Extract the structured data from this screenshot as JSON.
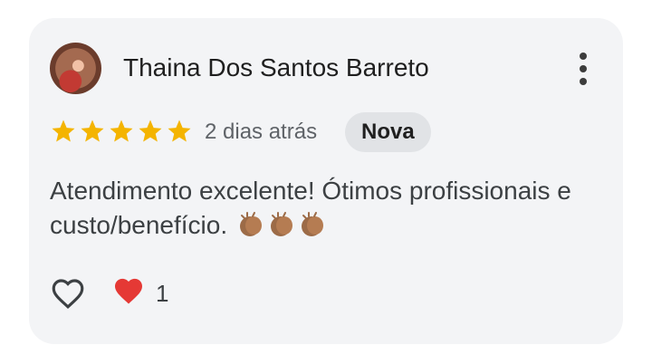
{
  "review": {
    "author": "Thaina Dos Santos Barreto",
    "rating": 5,
    "date": "2 dias atrás",
    "badge": "Nova",
    "text": "Atendimento excelente! Ótimos profissionais e custo/benefício.",
    "emoji": "clapping-hands",
    "reactions": {
      "heart_count": "1"
    }
  },
  "colors": {
    "card_bg": "#f3f4f6",
    "star": "#f4b400",
    "heart": "#e53935",
    "badge_bg": "#e1e3e6"
  },
  "icons": [
    "more-vert-icon",
    "star-icon",
    "heart-outline-icon",
    "heart-icon",
    "clapping-hands-icon"
  ]
}
